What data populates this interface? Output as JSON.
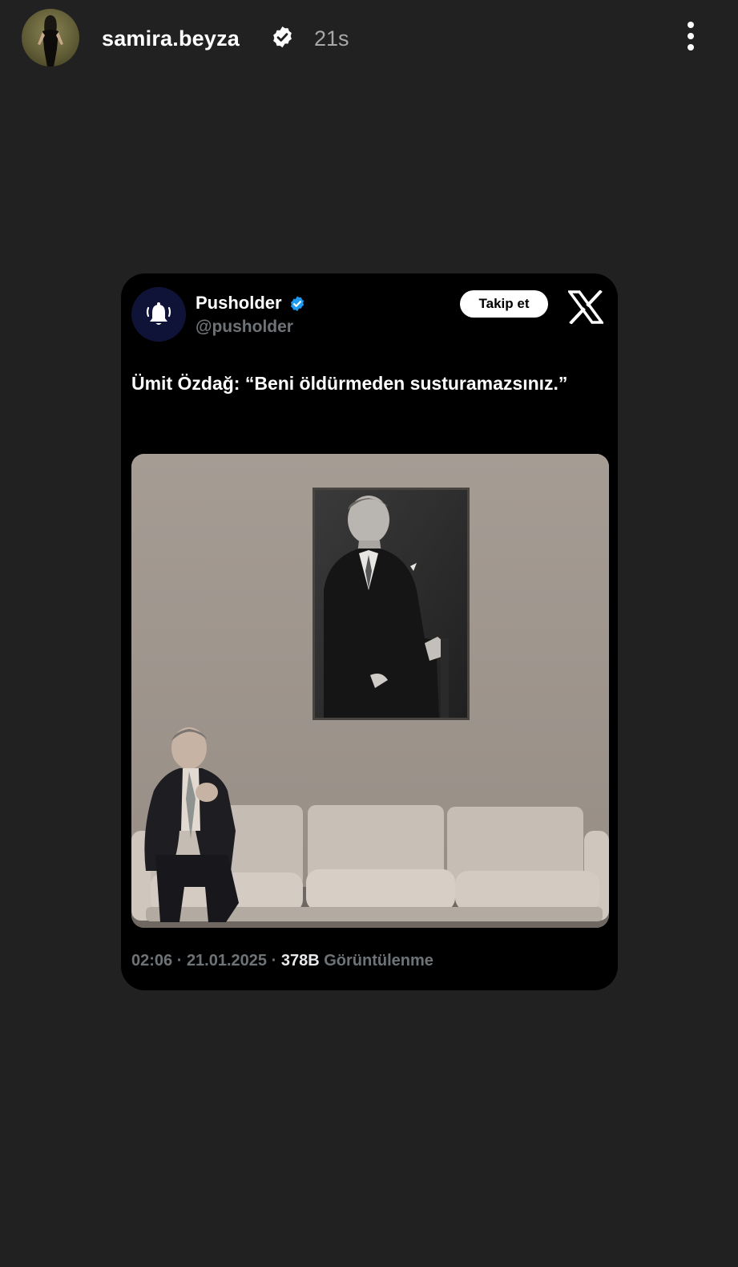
{
  "story": {
    "username": "samira.beyza",
    "time_ago": "21s",
    "avatar_icon": "user-avatar",
    "verified_icon": "verified-badge-icon",
    "more_icon": "more-vertical-icon"
  },
  "tweet": {
    "author_name": "Pusholder",
    "author_handle": "@pusholder",
    "avatar_icon": "bell-icon",
    "verified_icon": "verified-badge-icon",
    "follow_label": "Takip et",
    "platform_icon": "x-logo-icon",
    "text": "Ümit Özdağ: “Beni öldürmeden susturamazsınız.”",
    "photo_icon": "photo",
    "time": "02:06",
    "separator": " · ",
    "date": "21.01.2025",
    "views_count": "378B",
    "views_label": "Görüntülenme"
  },
  "colors": {
    "background": "#212121",
    "card": "#000000",
    "verified_blue": "#1d9bf0",
    "muted_text": "#6e7377",
    "follow_button_bg": "#ffffff"
  }
}
